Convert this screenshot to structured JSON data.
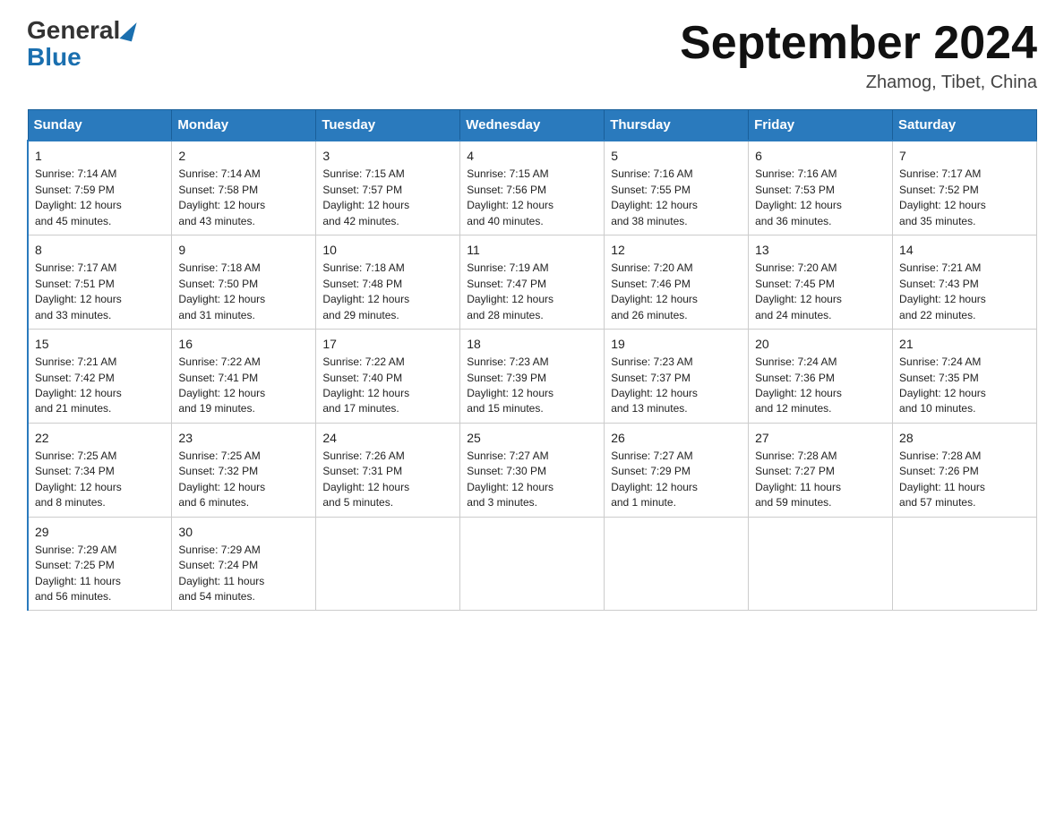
{
  "header": {
    "logo_general": "General",
    "logo_blue": "Blue",
    "title": "September 2024",
    "location": "Zhamog, Tibet, China"
  },
  "days_of_week": [
    "Sunday",
    "Monday",
    "Tuesday",
    "Wednesday",
    "Thursday",
    "Friday",
    "Saturday"
  ],
  "weeks": [
    [
      {
        "day": "1",
        "sunrise": "7:14 AM",
        "sunset": "7:59 PM",
        "daylight": "12 hours and 45 minutes."
      },
      {
        "day": "2",
        "sunrise": "7:14 AM",
        "sunset": "7:58 PM",
        "daylight": "12 hours and 43 minutes."
      },
      {
        "day": "3",
        "sunrise": "7:15 AM",
        "sunset": "7:57 PM",
        "daylight": "12 hours and 42 minutes."
      },
      {
        "day": "4",
        "sunrise": "7:15 AM",
        "sunset": "7:56 PM",
        "daylight": "12 hours and 40 minutes."
      },
      {
        "day": "5",
        "sunrise": "7:16 AM",
        "sunset": "7:55 PM",
        "daylight": "12 hours and 38 minutes."
      },
      {
        "day": "6",
        "sunrise": "7:16 AM",
        "sunset": "7:53 PM",
        "daylight": "12 hours and 36 minutes."
      },
      {
        "day": "7",
        "sunrise": "7:17 AM",
        "sunset": "7:52 PM",
        "daylight": "12 hours and 35 minutes."
      }
    ],
    [
      {
        "day": "8",
        "sunrise": "7:17 AM",
        "sunset": "7:51 PM",
        "daylight": "12 hours and 33 minutes."
      },
      {
        "day": "9",
        "sunrise": "7:18 AM",
        "sunset": "7:50 PM",
        "daylight": "12 hours and 31 minutes."
      },
      {
        "day": "10",
        "sunrise": "7:18 AM",
        "sunset": "7:48 PM",
        "daylight": "12 hours and 29 minutes."
      },
      {
        "day": "11",
        "sunrise": "7:19 AM",
        "sunset": "7:47 PM",
        "daylight": "12 hours and 28 minutes."
      },
      {
        "day": "12",
        "sunrise": "7:20 AM",
        "sunset": "7:46 PM",
        "daylight": "12 hours and 26 minutes."
      },
      {
        "day": "13",
        "sunrise": "7:20 AM",
        "sunset": "7:45 PM",
        "daylight": "12 hours and 24 minutes."
      },
      {
        "day": "14",
        "sunrise": "7:21 AM",
        "sunset": "7:43 PM",
        "daylight": "12 hours and 22 minutes."
      }
    ],
    [
      {
        "day": "15",
        "sunrise": "7:21 AM",
        "sunset": "7:42 PM",
        "daylight": "12 hours and 21 minutes."
      },
      {
        "day": "16",
        "sunrise": "7:22 AM",
        "sunset": "7:41 PM",
        "daylight": "12 hours and 19 minutes."
      },
      {
        "day": "17",
        "sunrise": "7:22 AM",
        "sunset": "7:40 PM",
        "daylight": "12 hours and 17 minutes."
      },
      {
        "day": "18",
        "sunrise": "7:23 AM",
        "sunset": "7:39 PM",
        "daylight": "12 hours and 15 minutes."
      },
      {
        "day": "19",
        "sunrise": "7:23 AM",
        "sunset": "7:37 PM",
        "daylight": "12 hours and 13 minutes."
      },
      {
        "day": "20",
        "sunrise": "7:24 AM",
        "sunset": "7:36 PM",
        "daylight": "12 hours and 12 minutes."
      },
      {
        "day": "21",
        "sunrise": "7:24 AM",
        "sunset": "7:35 PM",
        "daylight": "12 hours and 10 minutes."
      }
    ],
    [
      {
        "day": "22",
        "sunrise": "7:25 AM",
        "sunset": "7:34 PM",
        "daylight": "12 hours and 8 minutes."
      },
      {
        "day": "23",
        "sunrise": "7:25 AM",
        "sunset": "7:32 PM",
        "daylight": "12 hours and 6 minutes."
      },
      {
        "day": "24",
        "sunrise": "7:26 AM",
        "sunset": "7:31 PM",
        "daylight": "12 hours and 5 minutes."
      },
      {
        "day": "25",
        "sunrise": "7:27 AM",
        "sunset": "7:30 PM",
        "daylight": "12 hours and 3 minutes."
      },
      {
        "day": "26",
        "sunrise": "7:27 AM",
        "sunset": "7:29 PM",
        "daylight": "12 hours and 1 minute."
      },
      {
        "day": "27",
        "sunrise": "7:28 AM",
        "sunset": "7:27 PM",
        "daylight": "11 hours and 59 minutes."
      },
      {
        "day": "28",
        "sunrise": "7:28 AM",
        "sunset": "7:26 PM",
        "daylight": "11 hours and 57 minutes."
      }
    ],
    [
      {
        "day": "29",
        "sunrise": "7:29 AM",
        "sunset": "7:25 PM",
        "daylight": "11 hours and 56 minutes."
      },
      {
        "day": "30",
        "sunrise": "7:29 AM",
        "sunset": "7:24 PM",
        "daylight": "11 hours and 54 minutes."
      },
      null,
      null,
      null,
      null,
      null
    ]
  ],
  "labels": {
    "sunrise": "Sunrise:",
    "sunset": "Sunset:",
    "daylight": "Daylight:"
  }
}
